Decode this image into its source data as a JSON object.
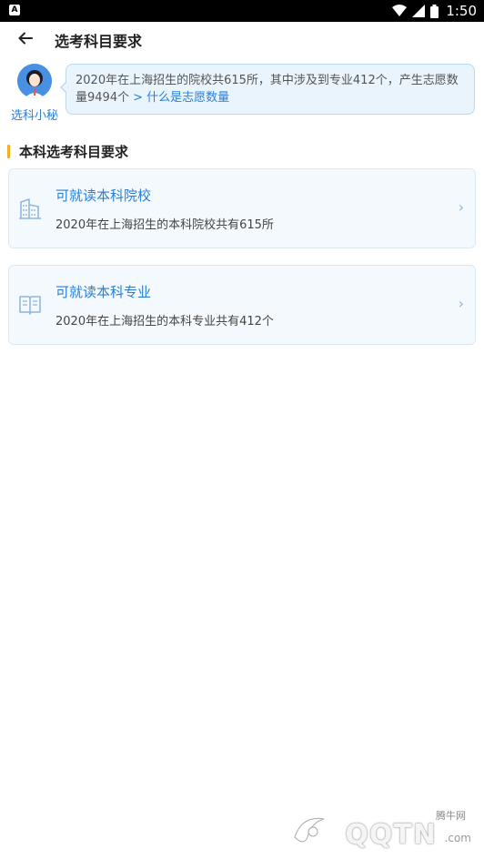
{
  "status_bar": {
    "app_badge": "A",
    "time": "1:50",
    "icons": [
      "wifi-icon",
      "signal-icon",
      "battery-icon"
    ]
  },
  "header": {
    "title": "选考科目要求",
    "back_icon": "arrow-left-icon"
  },
  "assistant": {
    "name": "选科小秘",
    "message": "2020年在上海招生的院校共615所，其中涉及到专业412个，产生志愿数量9494个",
    "link_text": "> 什么是志愿数量"
  },
  "section": {
    "title": "本科选考科目要求",
    "accent_color": "#f2b01e"
  },
  "cards": [
    {
      "title": "可就读本科院校",
      "description": "2020年在上海招生的本科院校共有615所",
      "icon": "building-icon",
      "chevron": "›"
    },
    {
      "title": "可就读本科专业",
      "description": "2020年在上海招生的本科专业共有412个",
      "icon": "book-icon",
      "chevron": "›"
    }
  ],
  "watermark": {
    "small_text": "腾牛网",
    "big_text": "QQTN",
    "suffix": ".com"
  },
  "colors": {
    "accent_blue": "#2a7fd4",
    "bubble_bg": "#e9f4fc",
    "card_bg": "#f4f9fd"
  }
}
